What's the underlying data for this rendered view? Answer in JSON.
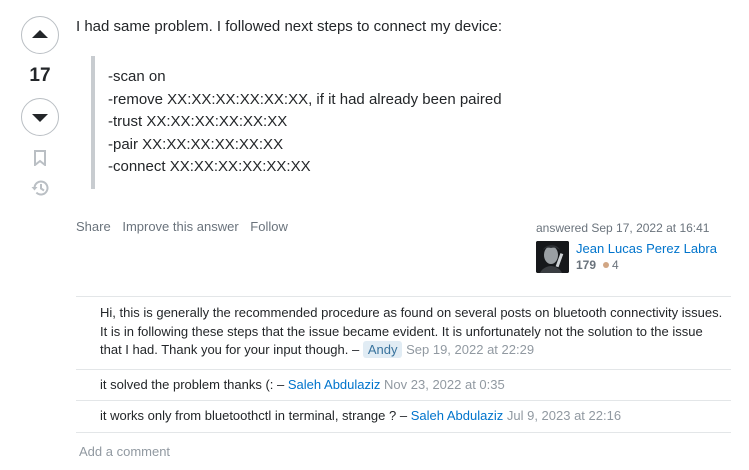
{
  "vote": {
    "count": "17"
  },
  "post": {
    "intro": "I had same problem. I followed next steps to connect my device:",
    "steps": [
      "-scan on",
      "-remove XX:XX:XX:XX:XX:XX, if it had already been paired",
      "-trust XX:XX:XX:XX:XX:XX",
      "-pair XX:XX:XX:XX:XX:XX",
      "-connect XX:XX:XX:XX:XX:XX"
    ]
  },
  "menu": {
    "share": "Share",
    "improve": "Improve this answer",
    "follow": "Follow"
  },
  "user": {
    "action": "answered Sep 17, 2022 at 16:41",
    "name": "Jean Lucas Perez Labra",
    "reputation": "179",
    "bronze_badges": "4"
  },
  "comments": [
    {
      "text": "Hi, this is generally the recommended procedure as found on several posts on bluetooth connectivity issues. It is in following these steps that the issue became evident. It is unfortunately not the solution to the issue that I had. Thank you for your input though. –",
      "user": "Andy",
      "date": "Sep 19, 2022 at 22:29"
    },
    {
      "text": "it solved the problem thanks (: –",
      "user": "Saleh Abdulaziz",
      "date": "Nov 23, 2022 at 0:35"
    },
    {
      "text": "it works only from bluetoothctl in terminal, strange ? –",
      "user": "Saleh Abdulaziz",
      "date": "Jul 9, 2023 at 22:16"
    }
  ],
  "add_comment": "Add a comment",
  "colors": {
    "link": "#0074cc",
    "muted": "#6a737c",
    "border": "#e3e6e8",
    "bronze": "#d1a684"
  }
}
